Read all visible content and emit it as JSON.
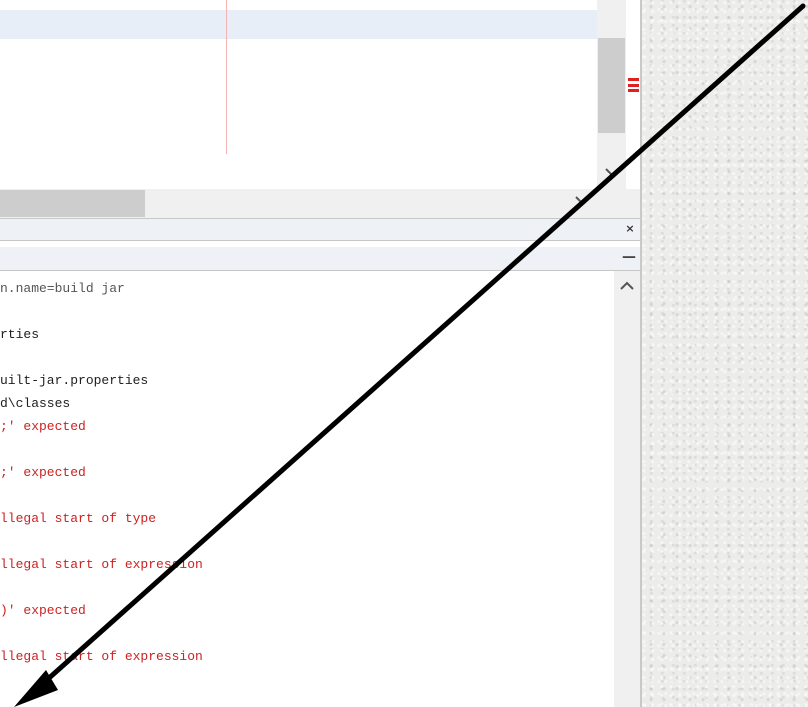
{
  "icons": {
    "scroll_down": "chevron-down-icon",
    "scroll_right": "chevron-right-icon",
    "scroll_up": "chevron-up-icon",
    "close": "close-icon",
    "minimize": "minimize-icon",
    "arrow": "annotation-arrow"
  },
  "panel": {
    "close_glyph": "×",
    "minimize_glyph": "—"
  },
  "colors": {
    "error_text": "#cc2222",
    "error_stripe": "#e02020",
    "arrow": "#000000"
  },
  "output": {
    "lines": [
      {
        "text": "n.name=build jar",
        "kind": "dim"
      },
      {
        "text": "rties",
        "kind": "plain"
      },
      {
        "text": "uilt-jar.properties",
        "kind": "plain"
      },
      {
        "text": "d\\classes",
        "kind": "plain"
      },
      {
        "text": ";' expected",
        "kind": "err"
      },
      {
        "text": ";' expected",
        "kind": "err"
      },
      {
        "text": "llegal start of type",
        "kind": "err"
      },
      {
        "text": "llegal start of expression",
        "kind": "err"
      },
      {
        "text": ")' expected",
        "kind": "err"
      },
      {
        "text": "llegal start of expression",
        "kind": "err"
      }
    ]
  }
}
